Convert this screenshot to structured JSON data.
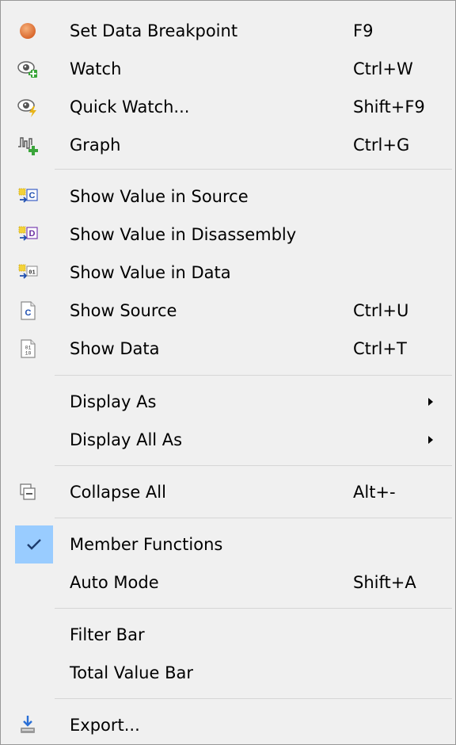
{
  "menu": {
    "items": [
      {
        "label": "Set Data Breakpoint",
        "shortcut": "F9",
        "icon": "breakpoint-icon"
      },
      {
        "label": "Watch",
        "shortcut": "Ctrl+W",
        "icon": "watch-icon"
      },
      {
        "label": "Quick Watch...",
        "shortcut": "Shift+F9",
        "icon": "quick-watch-icon"
      },
      {
        "label": "Graph",
        "shortcut": "Ctrl+G",
        "icon": "graph-icon"
      },
      {
        "label": "Show Value in Source",
        "shortcut": "",
        "icon": "show-value-source-icon"
      },
      {
        "label": "Show Value in Disassembly",
        "shortcut": "",
        "icon": "show-value-disassembly-icon"
      },
      {
        "label": "Show Value in Data",
        "shortcut": "",
        "icon": "show-value-data-icon"
      },
      {
        "label": "Show Source",
        "shortcut": "Ctrl+U",
        "icon": "source-file-icon"
      },
      {
        "label": "Show Data",
        "shortcut": "Ctrl+T",
        "icon": "data-file-icon"
      },
      {
        "label": "Display As",
        "shortcut": "",
        "submenu": true
      },
      {
        "label": "Display All As",
        "shortcut": "",
        "submenu": true
      },
      {
        "label": "Collapse All",
        "shortcut": "Alt+-",
        "icon": "collapse-all-icon"
      },
      {
        "label": "Member Functions",
        "shortcut": "",
        "checked": true,
        "icon": "checkmark-icon"
      },
      {
        "label": "Auto Mode",
        "shortcut": "Shift+A"
      },
      {
        "label": "Filter Bar",
        "shortcut": ""
      },
      {
        "label": "Total Value Bar",
        "shortcut": ""
      },
      {
        "label": "Export...",
        "shortcut": "",
        "icon": "export-icon"
      }
    ]
  },
  "colors": {
    "menu_background": "#f0f0f0",
    "menu_border": "#979797",
    "separator": "#d6d6d6",
    "check_highlight": "#99ccff"
  }
}
